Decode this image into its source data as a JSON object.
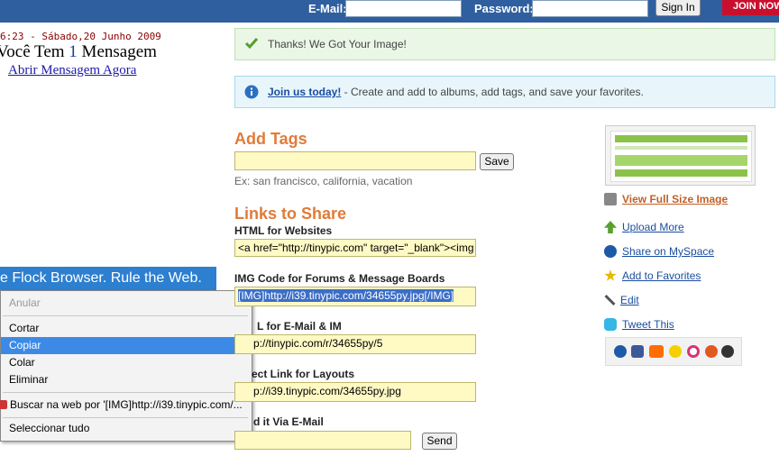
{
  "topbar": {
    "email_label": "E-Mail:",
    "password_label": "Password:",
    "signin_label": "Sign In",
    "join_label": "JOIN NOW"
  },
  "left": {
    "clock": "6:23 - Sábado,20 Junho 2009",
    "message_prefix": "Você Tem ",
    "message_count": "1",
    "message_suffix": " Mensagem",
    "message_link": "Abrir Mensagem Agora",
    "flock_banner": "e Flock Browser. Rule the Web."
  },
  "context_menu": {
    "items": [
      {
        "label": "Anular",
        "state": "disabled"
      },
      {
        "label": "Cortar",
        "state": "normal"
      },
      {
        "label": "Copiar",
        "state": "selected"
      },
      {
        "label": "Colar",
        "state": "normal"
      },
      {
        "label": "Eliminar",
        "state": "normal"
      },
      {
        "label": "Buscar na web por '[IMG]http://i39.tinypic.com/...",
        "state": "normal"
      },
      {
        "label": "Seleccionar tudo",
        "state": "normal"
      }
    ]
  },
  "notices": {
    "success": "Thanks! We Got Your Image!",
    "info_link": "Join us today!",
    "info_text": " - Create and add to albums, add tags, and save your favorites."
  },
  "tags": {
    "heading": "Add Tags",
    "input_value": "",
    "save_label": "Save",
    "hint": "Ex: san francisco, california, vacation"
  },
  "links": {
    "heading": "Links to Share",
    "html_label": "HTML for Websites",
    "html_value": "<a href=\"http://tinypic.com\" target=\"_blank\"><img",
    "img_label": "IMG Code for Forums & Message Boards",
    "img_value": "[IMG]http://i39.tinypic.com/34655py.jpg[/IMG]",
    "email_label": "L for E-Mail & IM",
    "email_value": "p://tinypic.com/r/34655py/5",
    "direct_label": "ect Link for Layouts",
    "direct_value": "p://i39.tinypic.com/34655py.jpg",
    "send_label": "d it Via E-Mail",
    "send_value": "",
    "send_button": "Send"
  },
  "sidebar": {
    "full_size": "View Full Size Image",
    "upload_more": "Upload More",
    "myspace": "Share on MySpace",
    "favorites": "Add to Favorites",
    "edit": "Edit",
    "tweet": "Tweet This",
    "share_icons": [
      "myspace-icon",
      "facebook-icon",
      "hi5-icon",
      "smiley-icon",
      "orkut-icon",
      "digg-icon",
      "wordpress-icon"
    ]
  }
}
